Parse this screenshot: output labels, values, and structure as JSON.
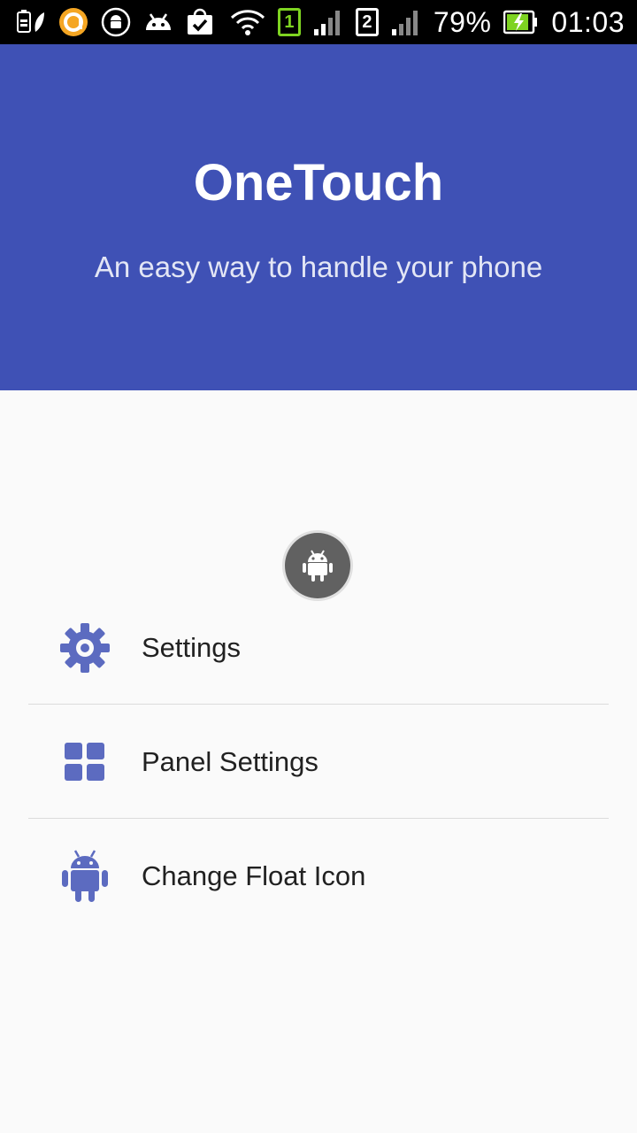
{
  "status_bar": {
    "sim1": "1",
    "sim2": "2",
    "battery_percent": "79%",
    "time": "01:03"
  },
  "header": {
    "title": "OneTouch",
    "subtitle": "An easy way to handle your phone",
    "background_color": "#3f51b5"
  },
  "float_icon": {
    "icon": "android-icon"
  },
  "menu": {
    "items": [
      {
        "label": "Settings",
        "icon": "gear-icon"
      },
      {
        "label": "Panel Settings",
        "icon": "grid-icon"
      },
      {
        "label": "Change Float Icon",
        "icon": "android-icon"
      }
    ],
    "icon_color": "#5c6bc0"
  }
}
